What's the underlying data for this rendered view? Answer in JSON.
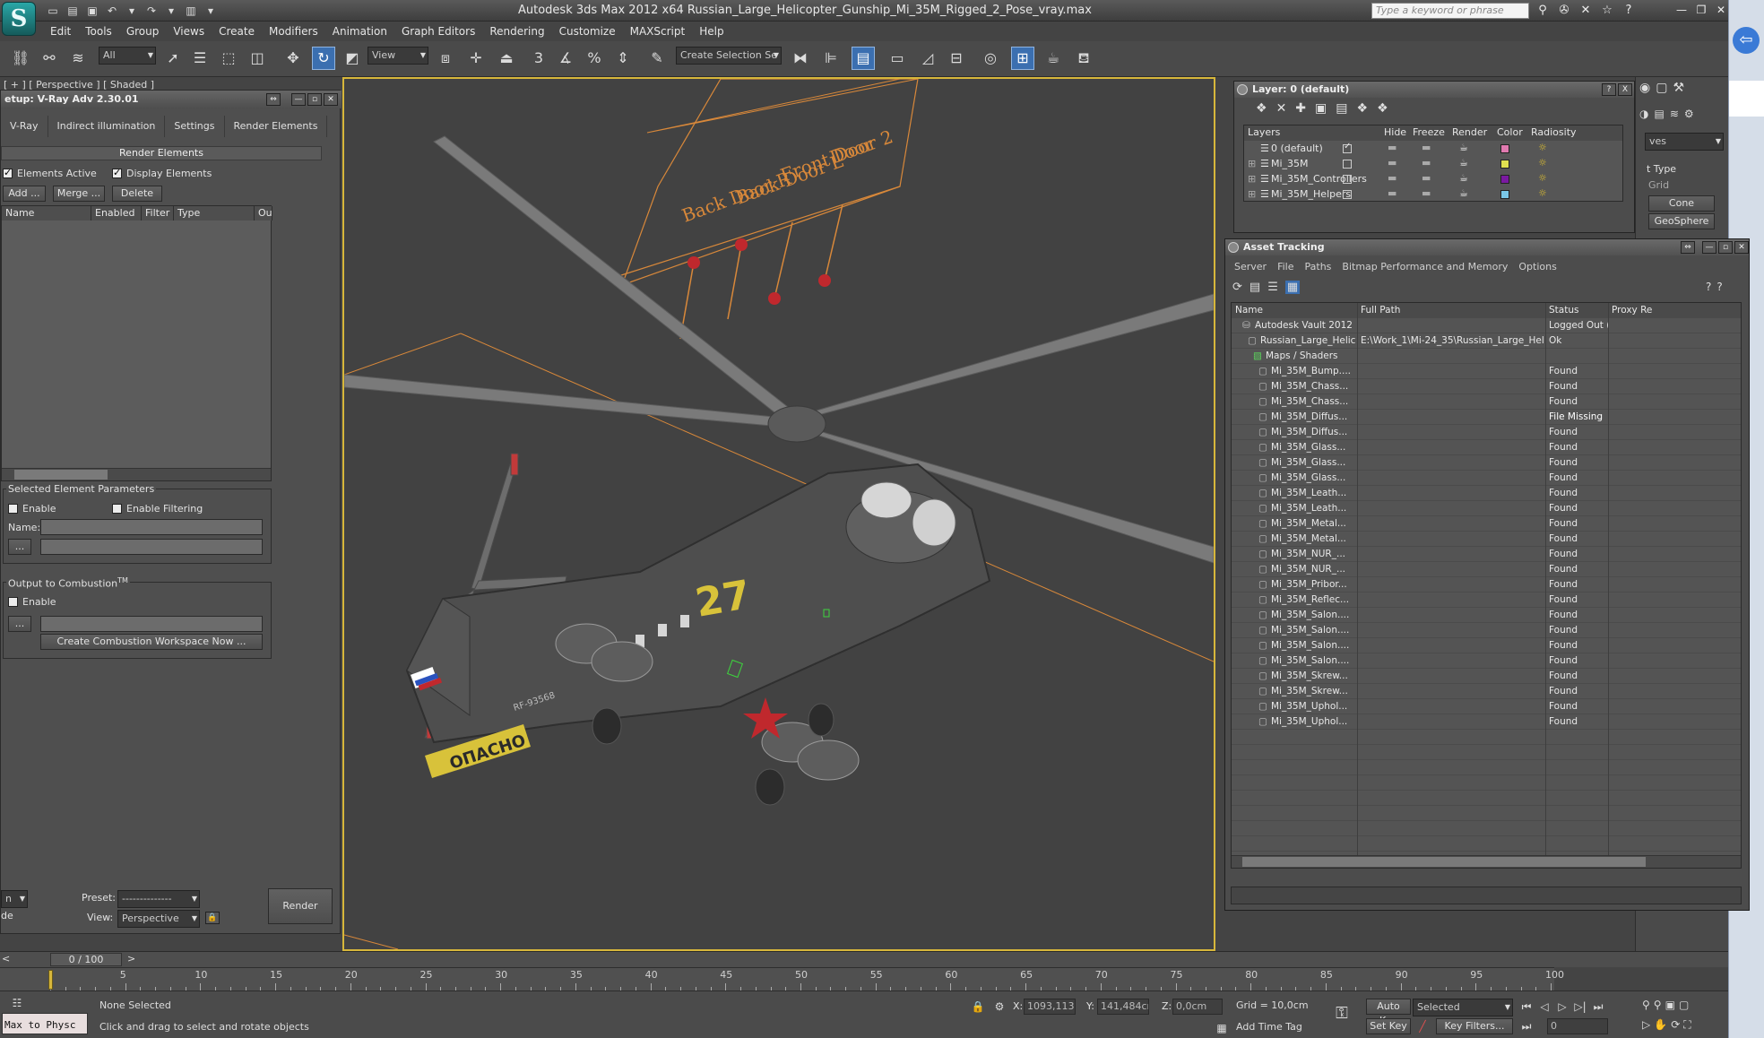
{
  "app": {
    "title": "Autodesk 3ds Max  2012 x64     Russian_Large_Helicopter_Gunship_Mi_35M_Rigged_2_Pose_vray.max",
    "logo_letter": "S",
    "search_placeholder": "Type a keyword or phrase",
    "accent": "#3b6fb0",
    "viewport_border": "#d7b73b"
  },
  "menubar": [
    "Edit",
    "Tools",
    "Group",
    "Views",
    "Create",
    "Modifiers",
    "Animation",
    "Graph Editors",
    "Rendering",
    "Customize",
    "MAXScript",
    "Help"
  ],
  "toolbar": {
    "filter_value": "All",
    "refcoord_value": "View",
    "named_selection_value": "Create Selection Se",
    "snap_labels": [
      "3",
      "%"
    ]
  },
  "viewport": {
    "label": "[ + ] [ Perspective ] [ Shaded ]",
    "manipulator_texts": [
      {
        "text": "Back Door R"
      },
      {
        "text": "Back Door L"
      },
      {
        "text": "Front Door 2"
      },
      {
        "text": "Door"
      }
    ],
    "fuselage_number": "27",
    "tail_text": "ОПАСНО",
    "side_code": "RF-93568",
    "roundel_color": "#c0282d"
  },
  "vray_panel": {
    "title": "Render Setup: V-Ray Adv 2.30.01",
    "title_visible": "etup: V-Ray Adv 2.30.01",
    "tabs": [
      "V-Ray",
      "Indirect illumination",
      "Settings",
      "Render Elements"
    ],
    "rollout": "Render Elements",
    "elements_active": "Elements Active",
    "display_elements": "Display Elements",
    "buttons": {
      "add": "Add ...",
      "merge": "Merge ...",
      "delete": "Delete"
    },
    "columns": [
      "Name",
      "Enabled",
      "Filter",
      "Type",
      "Ou"
    ],
    "selected_params": {
      "title": "Selected Element Parameters",
      "enable": "Enable",
      "enable_filtering": "Enable Filtering",
      "name_label": "Name:",
      "browse": "..."
    },
    "combustion": {
      "title": "Output to Combustion",
      "tm": "TM",
      "enable": "Enable",
      "browse": "...",
      "create": "Create Combustion Workspace Now ..."
    },
    "bottom": {
      "mode_value": "n",
      "mode2": "de",
      "preset_label": "Preset:",
      "preset_value": "--------------",
      "view_label": "View:",
      "view_value": "Perspective",
      "render": "Render"
    }
  },
  "layer_dialog": {
    "title": "Layer: 0 (default)",
    "help": "?",
    "close": "X",
    "columns": [
      "Layers",
      "Hide",
      "Freeze",
      "Render",
      "Color",
      "Radiosity"
    ],
    "rows": [
      {
        "name": "0 (default)",
        "color": "#e07ab0",
        "active": true
      },
      {
        "name": "Mi_35M",
        "color": "#e0e050",
        "active": false
      },
      {
        "name": "Mi_35M_Controllers",
        "color": "#7a1aa0",
        "active": false
      },
      {
        "name": "Mi_35M_Helpers",
        "color": "#7ac8e8",
        "active": false
      }
    ]
  },
  "command_panel": {
    "dropdown": "ves",
    "section": "t Type",
    "sub": "Grid",
    "buttons": [
      "Cone",
      "GeoSphere"
    ]
  },
  "asset_tracking": {
    "title": "Asset Tracking",
    "menu": [
      "Server",
      "File",
      "Paths",
      "Bitmap Performance and Memory",
      "Options"
    ],
    "columns": [
      "Name",
      "Full Path",
      "Status",
      "Proxy Re"
    ],
    "rows": [
      {
        "indent": 2,
        "name": "Autodesk Vault 2012",
        "path": "",
        "status": "Logged Out (..."
      },
      {
        "indent": 3,
        "name": "Russian_Large_Helico...",
        "path": "E:\\Work_1\\Mi-24_35\\Russian_Large_Helicopter_...",
        "status": "Ok"
      },
      {
        "indent": 4,
        "name": "Maps / Shaders",
        "path": "",
        "status": ""
      },
      {
        "indent": 5,
        "name": "Mi_35M_Bump....",
        "path": "",
        "status": "Found"
      },
      {
        "indent": 5,
        "name": "Mi_35M_Chass...",
        "path": "",
        "status": "Found"
      },
      {
        "indent": 5,
        "name": "Mi_35M_Chass...",
        "path": "",
        "status": "Found"
      },
      {
        "indent": 5,
        "name": "Mi_35M_Diffus...",
        "path": "",
        "status": "File Missing"
      },
      {
        "indent": 5,
        "name": "Mi_35M_Diffus...",
        "path": "",
        "status": "Found"
      },
      {
        "indent": 5,
        "name": "Mi_35M_Glass...",
        "path": "",
        "status": "Found"
      },
      {
        "indent": 5,
        "name": "Mi_35M_Glass...",
        "path": "",
        "status": "Found"
      },
      {
        "indent": 5,
        "name": "Mi_35M_Glass...",
        "path": "",
        "status": "Found"
      },
      {
        "indent": 5,
        "name": "Mi_35M_Leath...",
        "path": "",
        "status": "Found"
      },
      {
        "indent": 5,
        "name": "Mi_35M_Leath...",
        "path": "",
        "status": "Found"
      },
      {
        "indent": 5,
        "name": "Mi_35M_Metal...",
        "path": "",
        "status": "Found"
      },
      {
        "indent": 5,
        "name": "Mi_35M_Metal...",
        "path": "",
        "status": "Found"
      },
      {
        "indent": 5,
        "name": "Mi_35M_NUR_...",
        "path": "",
        "status": "Found"
      },
      {
        "indent": 5,
        "name": "Mi_35M_NUR_...",
        "path": "",
        "status": "Found"
      },
      {
        "indent": 5,
        "name": "Mi_35M_Pribor...",
        "path": "",
        "status": "Found"
      },
      {
        "indent": 5,
        "name": "Mi_35M_Reflec...",
        "path": "",
        "status": "Found"
      },
      {
        "indent": 5,
        "name": "Mi_35M_Salon....",
        "path": "",
        "status": "Found"
      },
      {
        "indent": 5,
        "name": "Mi_35M_Salon....",
        "path": "",
        "status": "Found"
      },
      {
        "indent": 5,
        "name": "Mi_35M_Salon....",
        "path": "",
        "status": "Found"
      },
      {
        "indent": 5,
        "name": "Mi_35M_Salon....",
        "path": "",
        "status": "Found"
      },
      {
        "indent": 5,
        "name": "Mi_35M_Skrew...",
        "path": "",
        "status": "Found"
      },
      {
        "indent": 5,
        "name": "Mi_35M_Skrew...",
        "path": "",
        "status": "Found"
      },
      {
        "indent": 5,
        "name": "Mi_35M_Uphol...",
        "path": "",
        "status": "Found"
      },
      {
        "indent": 5,
        "name": "Mi_35M_Uphol...",
        "path": "",
        "status": "Found"
      }
    ]
  },
  "timeline": {
    "frame_label": "0 / 100",
    "prev": "<",
    "next": ">",
    "ticks": [
      0,
      5,
      10,
      15,
      20,
      25,
      30,
      35,
      40,
      45,
      50,
      55,
      60,
      65,
      70,
      75,
      80,
      85,
      90,
      95,
      100
    ],
    "current": 0,
    "max": 100
  },
  "statusbar": {
    "script_listener": "Max to Physc",
    "selection": "None Selected",
    "prompt": "Click and drag to select and rotate objects",
    "x_label": "X:",
    "x_value": "1093,113c",
    "y_label": "Y:",
    "y_value": "141,484cm",
    "z_label": "Z:",
    "z_value": "0,0cm",
    "grid": "Grid = 10,0cm",
    "add_time_tag": "Add Time Tag",
    "auto_key": "Auto Key",
    "set_key": "Set Key",
    "key_mode": "Selected",
    "key_filters": "Key Filters...",
    "frame_value": "0"
  }
}
